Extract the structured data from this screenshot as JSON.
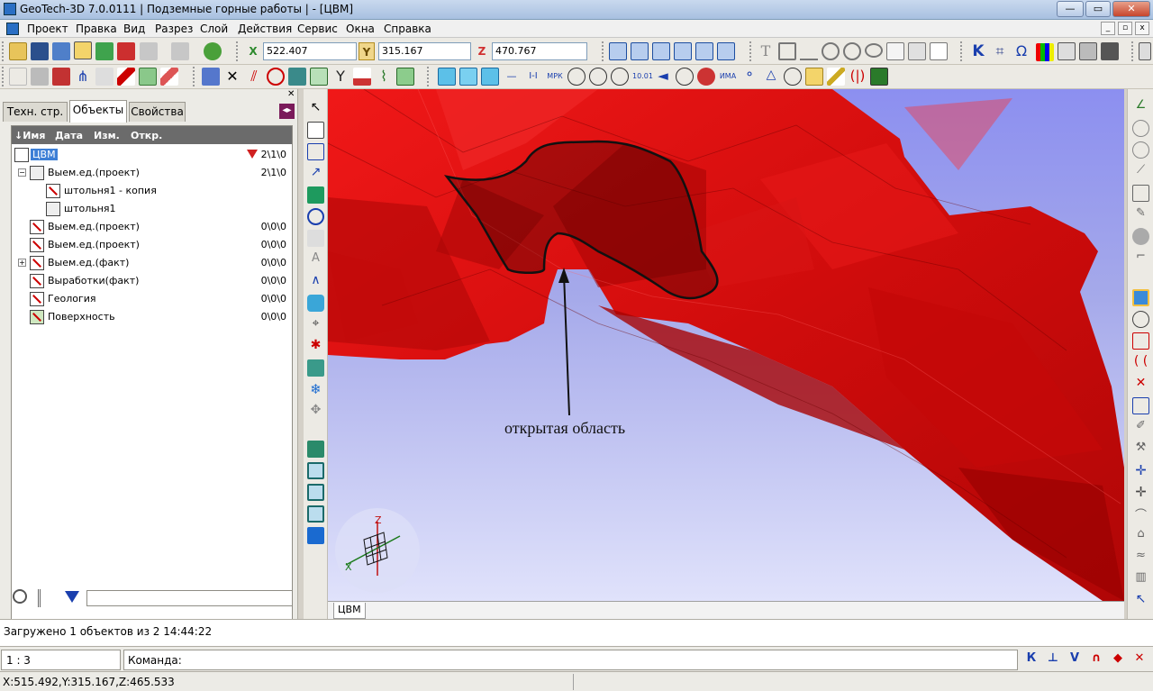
{
  "window": {
    "title": "GeoTech-3D 7.0.0111 | Подземные горные работы | - [ЦВМ]",
    "min": "—",
    "max": "▭",
    "close": "✕"
  },
  "menu": [
    "Проект",
    "Правка",
    "Вид",
    "Разрез",
    "Слой",
    "Действия",
    "Сервис",
    "Окна",
    "Справка"
  ],
  "coords_toolbar": {
    "x_label": "X",
    "x_value": "522.407",
    "y_label": "Y",
    "y_value": "315.167",
    "z_label": "Z",
    "z_value": "470.767"
  },
  "panel": {
    "tabs": [
      "Техн. стр.",
      "Объекты",
      "Свойства"
    ],
    "active_tab": "Объекты",
    "tree_headers": [
      "↓Имя",
      "Дата",
      "Изм.",
      "Откр."
    ],
    "root": {
      "label": "ЦВМ",
      "count": "2\\1\\0"
    },
    "items": [
      {
        "label": "Выем.ед.(проект)",
        "count": "2\\1\\0"
      },
      {
        "label": "штольня1 - копия",
        "count": ""
      },
      {
        "label": "штольня1",
        "count": ""
      },
      {
        "label": "Выем.ед.(проект)",
        "count": "0\\0\\0"
      },
      {
        "label": "Выем.ед.(проект)",
        "count": "0\\0\\0"
      },
      {
        "label": "Выем.ед.(факт)",
        "count": "0\\0\\0"
      },
      {
        "label": "Выработки(факт)",
        "count": "0\\0\\0"
      },
      {
        "label": "Геология",
        "count": "0\\0\\0"
      },
      {
        "label": "Поверхность",
        "count": "0\\0\\0"
      }
    ],
    "search_value": ""
  },
  "viewport": {
    "annotation": "открытая область",
    "axis_z": "Z",
    "axis_x": "X",
    "tab_label": "ЦВМ"
  },
  "status": {
    "message": "Загружено 1 объектов из 2 14:44:22",
    "scale": "1 : 3",
    "command_label": "Команда:",
    "cursor": "X:515.492,Y:315.167,Z:465.533"
  },
  "snap_buttons": [
    "К",
    "⊥",
    "V",
    "∩",
    "◆",
    "✕"
  ],
  "colors": {
    "mesh_red": "#e01010",
    "sky_top": "#8c8ff0",
    "tree_header": "#6b6b6b"
  }
}
